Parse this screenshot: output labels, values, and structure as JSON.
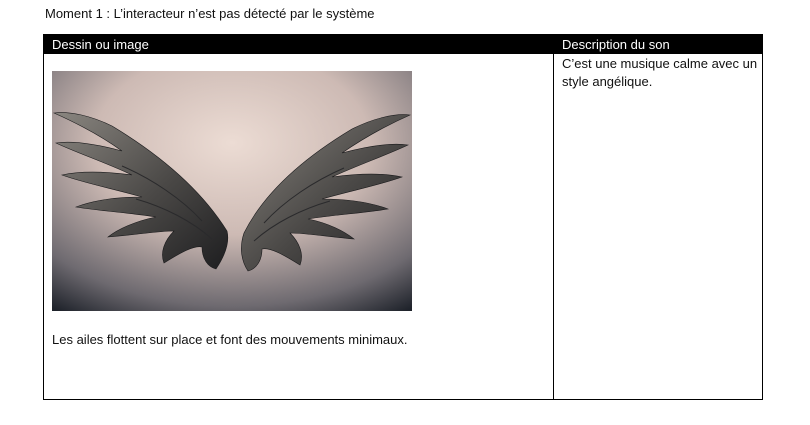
{
  "heading": "Moment 1 : L’interacteur n’est pas détecté par le système",
  "table": {
    "headers": {
      "image": "Dessin ou image",
      "sound": "Description du son"
    },
    "image_cell": {
      "picture": "angel-wings-photo",
      "caption": "Les ailes flottent sur place et font des mouvements minimaux."
    },
    "sound_cell": {
      "description": "C’est une musique calme avec un style angélique."
    }
  },
  "colors": {
    "header_bg": "#000000",
    "header_text": "#ffffff",
    "border": "#000000",
    "photo_bg_light": "#ead8d0",
    "photo_bg_dark": "#1f232b",
    "feather_dark": "#2a2a2c",
    "feather_light": "#8a8680"
  }
}
